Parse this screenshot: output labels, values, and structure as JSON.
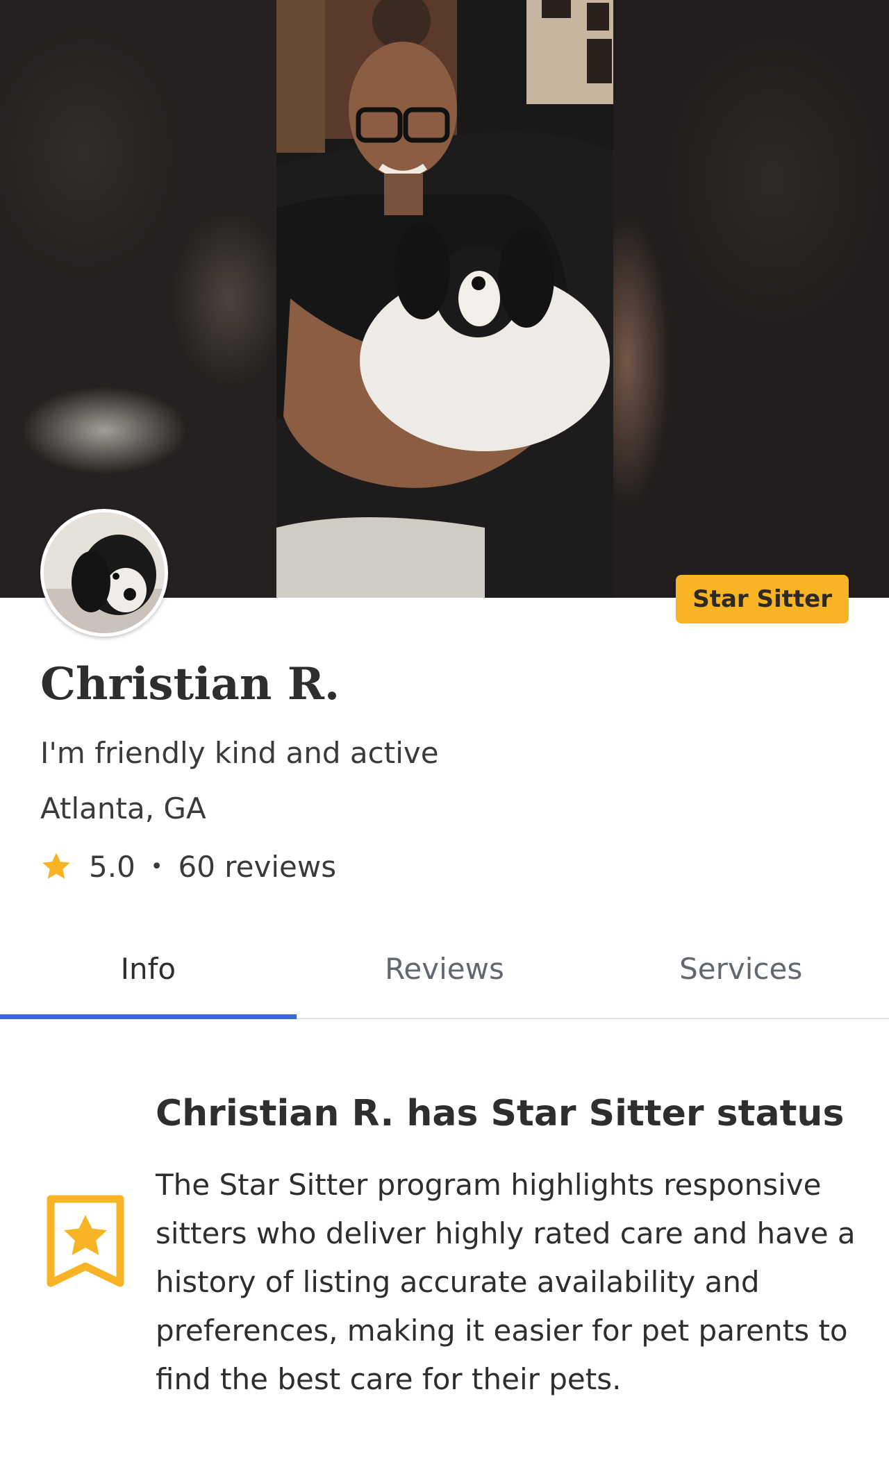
{
  "profile": {
    "name": "Christian R.",
    "tagline": "I'm friendly kind and active",
    "location": "Atlanta, GA",
    "rating": "5.0",
    "rating_separator": "•",
    "reviews": "60 reviews",
    "badge": "Star Sitter"
  },
  "tabs": [
    {
      "label": "Info",
      "active": true
    },
    {
      "label": "Reviews",
      "active": false
    },
    {
      "label": "Services",
      "active": false
    }
  ],
  "star_sitter": {
    "title": "Christian R. has Star Sitter status",
    "body": "The Star Sitter program highlights responsive sitters who deliver highly rated care and have a history of listing accurate availability and preferences, making it easier for pet parents to find the best care for their pets."
  },
  "icons": {
    "rating": "star-icon",
    "status": "bookmark-star-icon"
  },
  "colors": {
    "accent": "#3b68d4",
    "badge": "#f8b424",
    "star": "#f8b424"
  }
}
